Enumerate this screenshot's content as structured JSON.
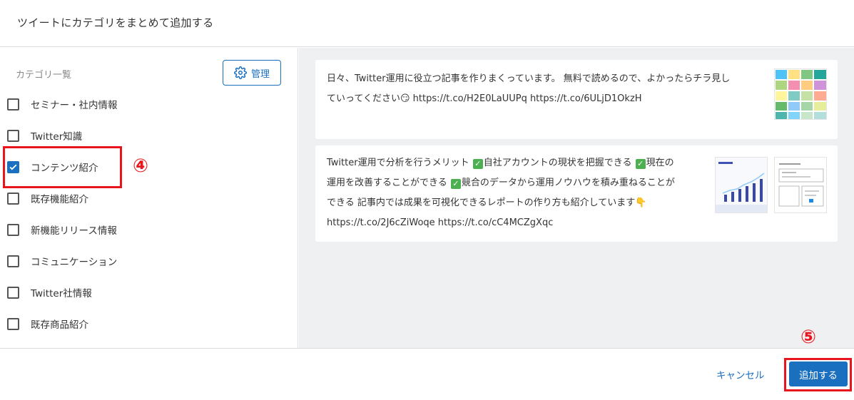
{
  "dialog": {
    "title": "ツイートにカテゴリをまとめて追加する"
  },
  "sidebar": {
    "list_title": "カテゴリ一覧",
    "manage_label": "管理",
    "categories": [
      {
        "label": "セミナー・社内情報",
        "checked": false
      },
      {
        "label": "Twitter知識",
        "checked": false
      },
      {
        "label": "コンテンツ紹介",
        "checked": true
      },
      {
        "label": "既存機能紹介",
        "checked": false
      },
      {
        "label": "新機能リリース情報",
        "checked": false
      },
      {
        "label": "コミュニケーション",
        "checked": false
      },
      {
        "label": "Twitter社情報",
        "checked": false
      },
      {
        "label": "既存商品紹介",
        "checked": false
      }
    ]
  },
  "tweets": [
    {
      "lines": [
        "日々、Twitter運用に役立つ記事を作りまくっています。 無料で読めるので、よかったらチラ見し",
        "ていってください😏 https://t.co/H2E0LaUUPq https://t.co/6ULjD1OkzH"
      ]
    },
    {
      "line1_a": "Twitter運用で分析を行うメリット ",
      "line1_b": "自社アカウントの現状を把握できる ",
      "line1_c": "現在の",
      "line2_a": "運用を改善することができる ",
      "line2_b": "競合のデータから運用ノウハウを積み重ねることが",
      "line3": "できる 記事内では成果を可視化できるレポートの作り方も紹介しています👇",
      "line4": "https://t.co/2J6cZiWoqe https://t.co/cC4MCZgXqc",
      "check_glyph": "✓"
    }
  ],
  "annotations": {
    "step4": "④",
    "step5": "⑤"
  },
  "footer": {
    "cancel_label": "キャンセル",
    "add_label": "追加する"
  },
  "colors": {
    "accent": "#1a6fbf",
    "highlight": "#e8161c",
    "check_emoji": "#4caf50"
  }
}
